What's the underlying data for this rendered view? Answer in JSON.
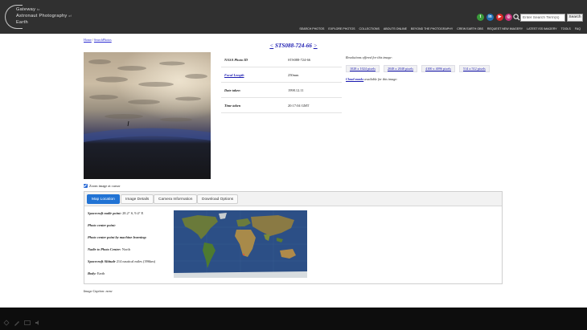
{
  "header": {
    "logo": {
      "line1": "Gateway",
      "line1_small": "to",
      "line2": "Astronaut Photography",
      "line2_small": "of",
      "line3": "Earth"
    },
    "social_icons": [
      {
        "name": "tumblr",
        "label": "t",
        "color": "#3a9a3a"
      },
      {
        "name": "linkedin",
        "label": "in",
        "color": "#1f6fb3"
      },
      {
        "name": "youtube",
        "label": "▶",
        "color": "#d62a2a"
      },
      {
        "name": "instagram",
        "label": "◎",
        "color": "#c7307a"
      }
    ],
    "search": {
      "placeholder": "Enter Search Term(s)",
      "button_label": "Search"
    },
    "nav_items": [
      "Search Photos",
      "Explore Photos",
      "Collections",
      "Abouts Online",
      "Beyond the Photography",
      "Crew Earth Obs",
      "Request New Imagery",
      "Latest ISS Imagery",
      "Tools",
      "FAQ"
    ]
  },
  "breadcrumb": {
    "home": "Home",
    "separator": "/",
    "current": "SearchPhotos"
  },
  "photo": {
    "prev_arrow": "<",
    "next_arrow": ">",
    "title": "STS088-724-66"
  },
  "info": [
    {
      "label": "NASA Photo ID",
      "value": "STS088-724-66",
      "link": false
    },
    {
      "label": "Focal Length",
      "value": "250mm",
      "link": true
    },
    {
      "label": "Date taken",
      "value": "1998.12.11",
      "link": false
    },
    {
      "label": "Time taken",
      "value": "20:17:04 GMT",
      "link": false
    }
  ],
  "resolutions": {
    "label": "Resolutions offered for this image:",
    "options": [
      "1028 x 1024 pixels",
      "2048 x 2048 pixels",
      "4100 x 4096 pixels",
      "514 x 512 pixels"
    ],
    "cloud_link": "Cloud masks",
    "cloud_suffix": "available for this image:"
  },
  "zoom": {
    "label": "Zoom image at cursor",
    "checked": true
  },
  "tabs": [
    "Map Location",
    "Image Details",
    "Camera Information",
    "Download Options"
  ],
  "map_info": {
    "nadir_label": "Spacecraft nadir point:",
    "nadir_value": "28.2° S, 9.4° E",
    "center_label": "Photo center point:",
    "center_value": "",
    "ml_label": "Photo center point by machine learning:",
    "ml_value": "",
    "direction_label": "Nadir to Photo Center:",
    "direction_value": "North",
    "altitude_label": "Spacecraft Altitude",
    "altitude_value": "214 nautical miles (396km)",
    "body_label": "Body:",
    "body_value": "Earth"
  },
  "caption": {
    "label": "Image Caption:",
    "value": "none"
  }
}
